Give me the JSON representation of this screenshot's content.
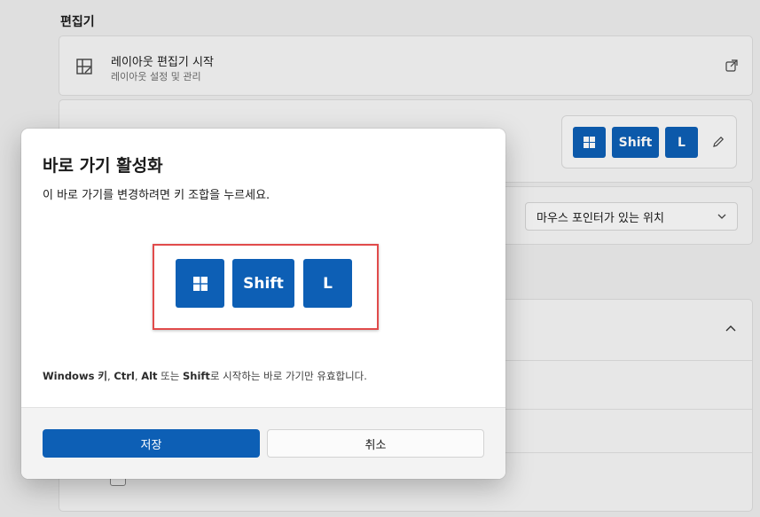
{
  "background": {
    "section_title": "편집기",
    "launch": {
      "title": "레이아웃 편집기 시작",
      "subtitle": "레이아웃 설정 및 관리"
    },
    "shortcut_keys": [
      "Shift",
      "L"
    ],
    "position_dropdown": "마우스 포인터가 있는 위치"
  },
  "dialog": {
    "title": "바로 가기 활성화",
    "description": "이 바로 가기를 변경하려면 키 조합을 누르세요.",
    "keys": [
      "Shift",
      "L"
    ],
    "note_parts": [
      "Windows 키",
      ", ",
      "Ctrl",
      ", ",
      "Alt",
      " 또는 ",
      "Shift",
      "로 시작하는 바로 가기만 유효합니다."
    ],
    "save_label": "저장",
    "cancel_label": "취소"
  },
  "colors": {
    "accent": "#0d5fb5",
    "highlight_border": "#e14b4b"
  },
  "icons": [
    "layout-editor-icon",
    "external-link-icon",
    "windows-logo-icon",
    "pencil-icon",
    "chevron-down-icon",
    "chevron-up-icon"
  ]
}
